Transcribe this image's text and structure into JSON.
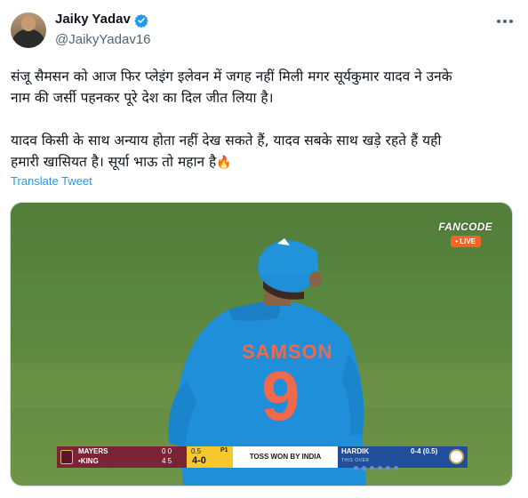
{
  "author": {
    "name": "Jaiky Yadav",
    "handle": "@JaikyYadav16"
  },
  "icons": {
    "verified": "verified-badge-icon",
    "more": "more-options-icon",
    "fire": "fire-emoji"
  },
  "tweet": {
    "line1": "संजू सैमसन को आज फिर प्लेइंग इलेवन में जगह नहीं मिली मगर सूर्यकुमार यादव ने उनके",
    "line2": "नाम की जर्सी पहनकर पूरे देश का दिल जीत लिया है।",
    "line3": "यादव किसी के साथ अन्याय होता नहीं देख सकते हैं, यादव सबके साथ खड़े रहते हैं यही",
    "line4": "हमारी खासियत है। सूर्या भाऊ तो महान है",
    "fire_emoji": "🔥",
    "translate": "Translate Tweet"
  },
  "media": {
    "broadcaster": "FANCODE",
    "live": "• LIVE",
    "jersey_name": "SAMSON",
    "jersey_number": "9",
    "scoreboard": {
      "batter1": "MAYERS",
      "batter1_score": "0 0",
      "batter2": "•KING",
      "batter2_score": "4 5",
      "overs": "0.5",
      "powerplay": "P1",
      "total": "4-0",
      "toss": "TOSS WON BY INDIA",
      "bowler": "HARDIK",
      "bowler_figures": "0-4 (0.5)",
      "this_over": "THIS OVER"
    }
  },
  "colors": {
    "verified": "#1d9bf0",
    "link": "#1d9bf0",
    "windies": "#7a2436",
    "india": "#1f4e9a",
    "jersey": "#1e8fd8",
    "pitch": "#6e9447"
  }
}
